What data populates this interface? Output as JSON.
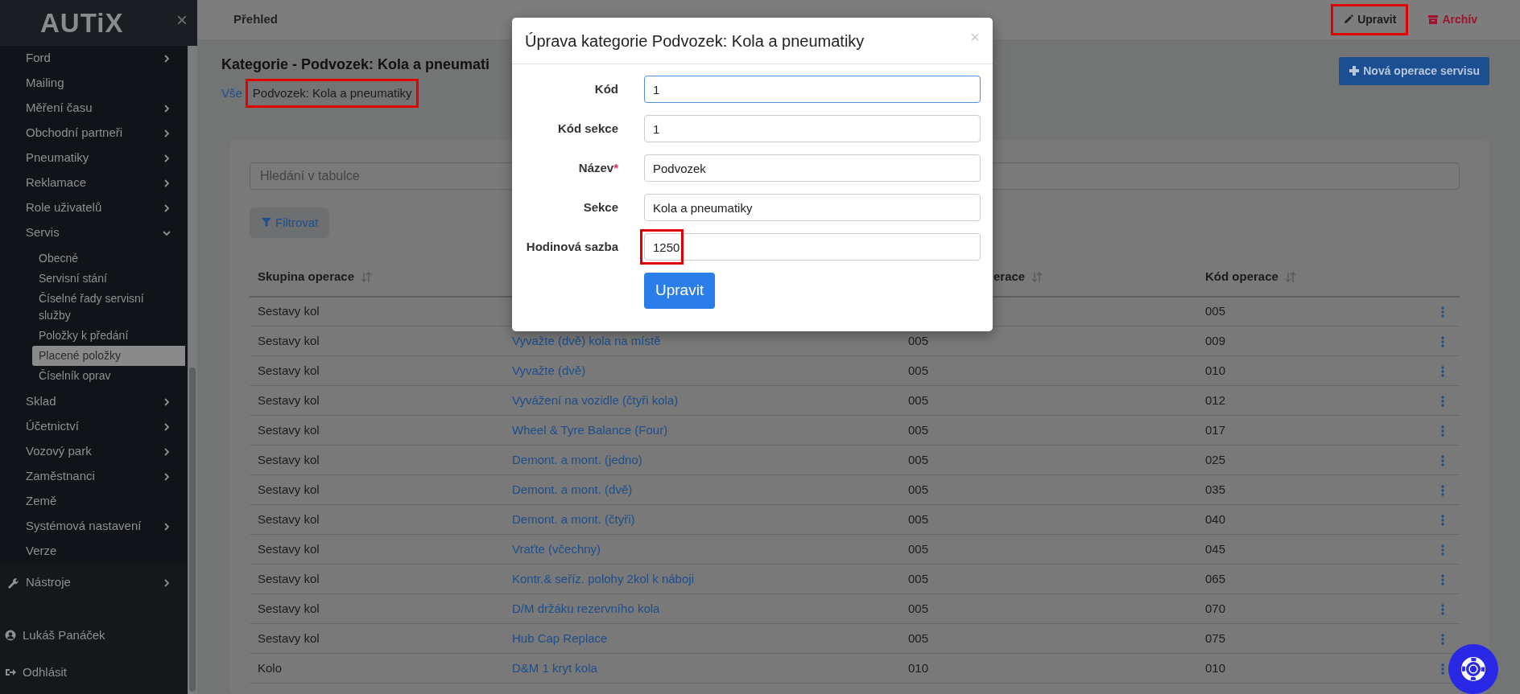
{
  "sidebar": {
    "logo": "AUTiX",
    "close": "×",
    "items": [
      {
        "label": "Ford",
        "kind": "group",
        "expanded": false,
        "selected": false
      },
      {
        "label": "Mailing",
        "kind": "link",
        "selected": false
      },
      {
        "label": "Měření času",
        "kind": "group",
        "expanded": false,
        "selected": false
      },
      {
        "label": "Obchodní partneři",
        "kind": "group",
        "expanded": false,
        "selected": false
      },
      {
        "label": "Pneumatiky",
        "kind": "group",
        "expanded": false,
        "selected": false
      },
      {
        "label": "Reklamace",
        "kind": "group",
        "expanded": false,
        "selected": false
      },
      {
        "label": "Role uživatelů",
        "kind": "group",
        "expanded": false,
        "selected": false
      },
      {
        "label": "Servis",
        "kind": "group",
        "expanded": true,
        "selected": false,
        "children": [
          {
            "label": "Obecné",
            "selected": false
          },
          {
            "label": "Servisní stání",
            "selected": false
          },
          {
            "label": "Číselné řady servisní služby",
            "selected": false
          },
          {
            "label": "Položky k předání",
            "selected": false
          },
          {
            "label": "Placené položky",
            "selected": true
          },
          {
            "label": "Číselník oprav",
            "selected": false
          }
        ]
      },
      {
        "label": "Sklad",
        "kind": "group",
        "expanded": false,
        "selected": false
      },
      {
        "label": "Účetnictví",
        "kind": "group",
        "expanded": false,
        "selected": false
      },
      {
        "label": "Vozový park",
        "kind": "group",
        "expanded": false,
        "selected": false
      },
      {
        "label": "Zaměstnanci",
        "kind": "group",
        "expanded": false,
        "selected": false
      },
      {
        "label": "Země",
        "kind": "link",
        "selected": false
      },
      {
        "label": "Systémová nastavení",
        "kind": "group",
        "expanded": false,
        "selected": false
      },
      {
        "label": "Verze",
        "kind": "link",
        "selected": false
      }
    ],
    "tools": {
      "label": "Nástroje",
      "expanded": false
    },
    "user": "Lukáš Panáček",
    "logout": "Odhlásit"
  },
  "topbar": {
    "tab": "Přehled",
    "actions": [
      {
        "label": "Upravit",
        "kind": "edit",
        "highlighted": true
      },
      {
        "label": "Archív",
        "kind": "archive",
        "highlighted": false
      }
    ]
  },
  "header": {
    "title": "Kategorie - Podvozek: Kola a pneumati",
    "breadcrumb": [
      {
        "label": "Vše",
        "kind": "link",
        "highlighted": false
      },
      {
        "label": "Podvozek: Kola a pneumatiky",
        "kind": "current",
        "highlighted": true
      }
    ],
    "new_button": "Nová operace servisu"
  },
  "search": {
    "placeholder": "Hledání v tabulce"
  },
  "filter_button": "Filtrovat",
  "table": {
    "columns": {
      "group": "Skupina operace",
      "column_3": "erace",
      "code": "Kód operace"
    },
    "rows": [
      {
        "group": "Sestavy kol",
        "code": "005"
      },
      {
        "group": "Sestavy kol",
        "operation": "Vyvažte (dvě) kola na místě",
        "column_3": "005",
        "code": "009"
      },
      {
        "group": "Sestavy kol",
        "operation": "Vyvažte (dvě)",
        "column_3": "005",
        "code": "010"
      },
      {
        "group": "Sestavy kol",
        "operation": "Vyvážení na vozidle (čtyři kola)",
        "column_3": "005",
        "code": "012"
      },
      {
        "group": "Sestavy kol",
        "operation": "Wheel & Tyre Balance (Four)",
        "column_3": "005",
        "code": "017"
      },
      {
        "group": "Sestavy kol",
        "operation": "Demont. a mont. (jedno)",
        "column_3": "005",
        "code": "025"
      },
      {
        "group": "Sestavy kol",
        "operation": "Demont. a mont. (dvě)",
        "column_3": "005",
        "code": "035"
      },
      {
        "group": "Sestavy kol",
        "operation": "Demont. a mont. (čtyři)",
        "column_3": "005",
        "code": "040"
      },
      {
        "group": "Sestavy kol",
        "operation": "Vraťte (včechny)",
        "column_3": "005",
        "code": "045"
      },
      {
        "group": "Sestavy kol",
        "operation": "Kontr.& seříz. polohy 2kol k náboji",
        "column_3": "005",
        "code": "065"
      },
      {
        "group": "Sestavy kol",
        "operation": "D/M držáku rezervního kola",
        "column_3": "005",
        "code": "070"
      },
      {
        "group": "Sestavy kol",
        "operation": "Hub Cap Replace",
        "column_3": "005",
        "code": "075"
      },
      {
        "group": "Kolo",
        "operation": "D&M 1 kryt kola",
        "column_3": "010",
        "code": "010"
      }
    ]
  },
  "modal": {
    "title": "Úprava kategorie Podvozek: Kola a pneumatiky",
    "close": "×",
    "fields": [
      {
        "label": "Kód",
        "value": "1",
        "focused": true,
        "highlighted": false
      },
      {
        "label": "Kód sekce",
        "value": "1",
        "focused": false,
        "highlighted": false
      },
      {
        "label": "Název",
        "mark": "*",
        "value": "Podvozek",
        "focused": false,
        "highlighted": false
      },
      {
        "label": "Sekce",
        "value": "Kola a pneumatiky",
        "focused": false,
        "highlighted": false
      },
      {
        "label": "Hodinová sazba",
        "value": "1250",
        "focused": false,
        "highlighted": true
      }
    ],
    "submit": "Upravit"
  }
}
